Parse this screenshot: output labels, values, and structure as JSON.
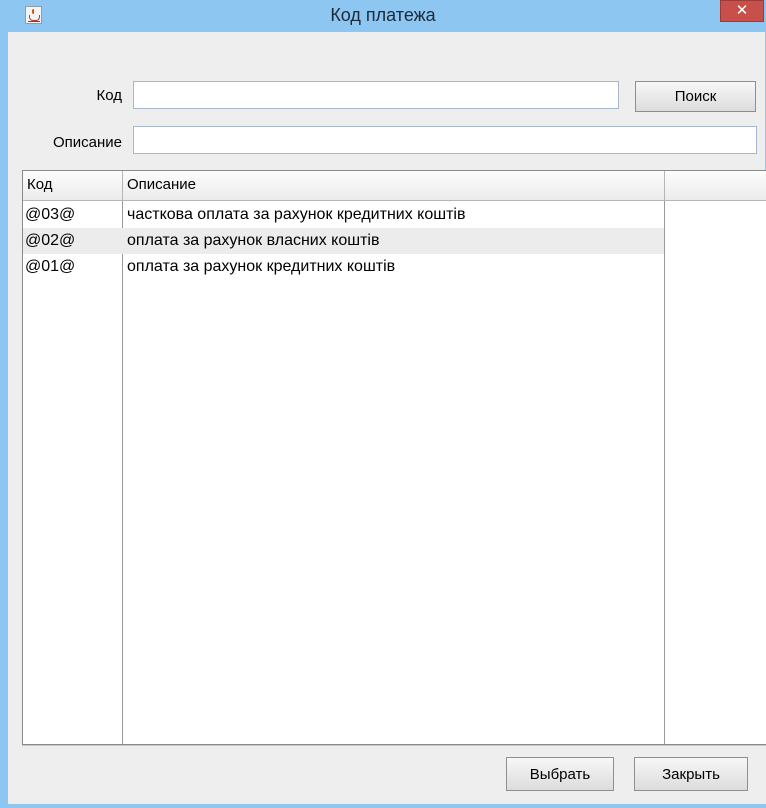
{
  "window": {
    "title": "Код платежа",
    "close_glyph": "✕",
    "app_icon": "java-cup-icon"
  },
  "search": {
    "code_label": "Код",
    "code_value": "",
    "description_label": "Описание",
    "description_value": "",
    "search_button": "Поиск"
  },
  "table": {
    "columns": [
      "Код",
      "Описание",
      ""
    ],
    "rows": [
      {
        "code": "@03@",
        "description": "часткова оплата за рахунок кредитних коштів"
      },
      {
        "code": "@02@",
        "description": "оплата за рахунок власних коштів"
      },
      {
        "code": "@01@",
        "description": "оплата за рахунок кредитних коштів"
      }
    ]
  },
  "footer": {
    "select_button": "Выбрать",
    "close_button": "Закрыть"
  },
  "colors": {
    "titlebar": "#8ec6f2",
    "close": "#c7504b",
    "client": "#eeeeee",
    "alt_row": "#ececec"
  }
}
